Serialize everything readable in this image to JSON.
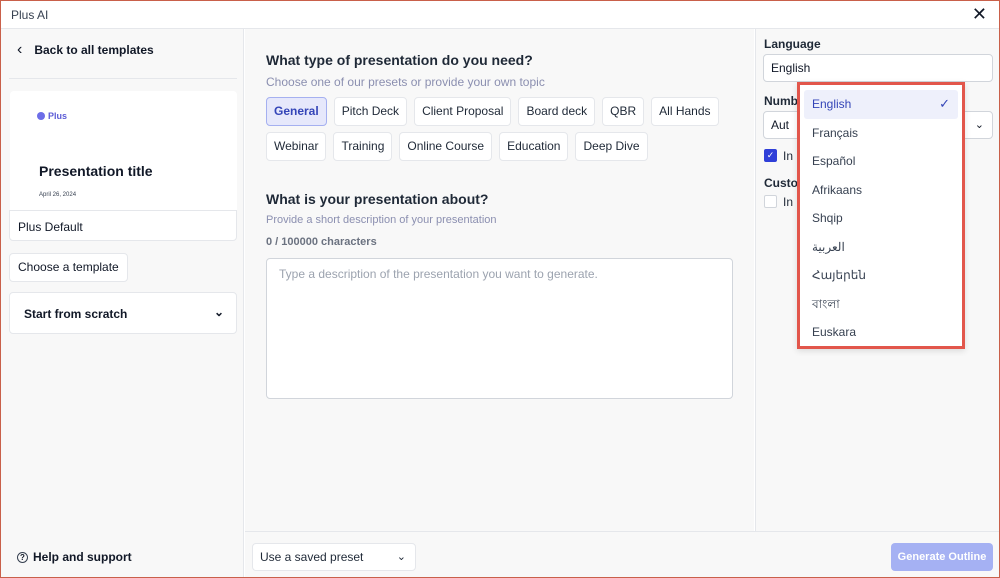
{
  "window": {
    "title": "Plus AI"
  },
  "sidebar": {
    "back_label": "Back to all templates",
    "thumbnail": {
      "logo": "Plus",
      "title": "Presentation title",
      "date": "April 26, 2024"
    },
    "template_name": "Plus Default",
    "choose_label": "Choose a template",
    "scratch_label": "Start from scratch",
    "help_label": "Help and support"
  },
  "main": {
    "question1": "What type of presentation do you need?",
    "hint1": "Choose one of our presets or provide your own topic",
    "presets": [
      "General",
      "Pitch Deck",
      "Client Proposal",
      "Board deck",
      "QBR",
      "All Hands",
      "Webinar",
      "Training",
      "Online Course",
      "Education",
      "Deep Dive"
    ],
    "active_preset": "General",
    "question2": "What is your presentation about?",
    "hint2": "Provide a short description of your presentation",
    "char_count": "0 / 100000 characters",
    "description_placeholder": "Type a description of the presentation you want to generate.",
    "description_value": ""
  },
  "footer": {
    "saved_preset_label": "Use a saved preset",
    "generate_label": "Generate Outline"
  },
  "settings": {
    "language_label": "Language",
    "language_value": "English",
    "slides_label_partial": "Numb",
    "slides_value_partial": "Aut",
    "checkbox1_partial": "In",
    "checkbox1_checked": true,
    "custom_label_partial": "Custo",
    "checkbox2_partial": "In",
    "checkbox2_checked": false
  },
  "language_dropdown": {
    "options": [
      "English",
      "Français",
      "Español",
      "Afrikaans",
      "Shqip",
      "العربية",
      "Հայերեն",
      "বাংলা",
      "Euskara"
    ],
    "selected": "English"
  },
  "colors": {
    "accent": "#3445b8",
    "chip_active_bg": "#e6e8fb",
    "generate_bg": "#a5b1f3",
    "highlight_border": "#e2564b",
    "window_border": "#c9604a"
  }
}
